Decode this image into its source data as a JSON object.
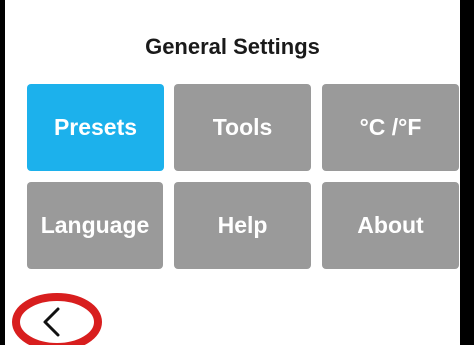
{
  "title": "General Settings",
  "buttons": [
    {
      "label": "Presets",
      "active": true
    },
    {
      "label": "Tools",
      "active": false
    },
    {
      "label": "°C /°F",
      "active": false
    },
    {
      "label": "Language",
      "active": false
    },
    {
      "label": "Help",
      "active": false
    },
    {
      "label": "About",
      "active": false
    }
  ],
  "back": {
    "icon": "chevron-left-icon",
    "highlight_color": "#d81e1e"
  },
  "colors": {
    "active": "#1cb1ec",
    "inactive": "#9a9a9a",
    "frame": "#000000"
  }
}
